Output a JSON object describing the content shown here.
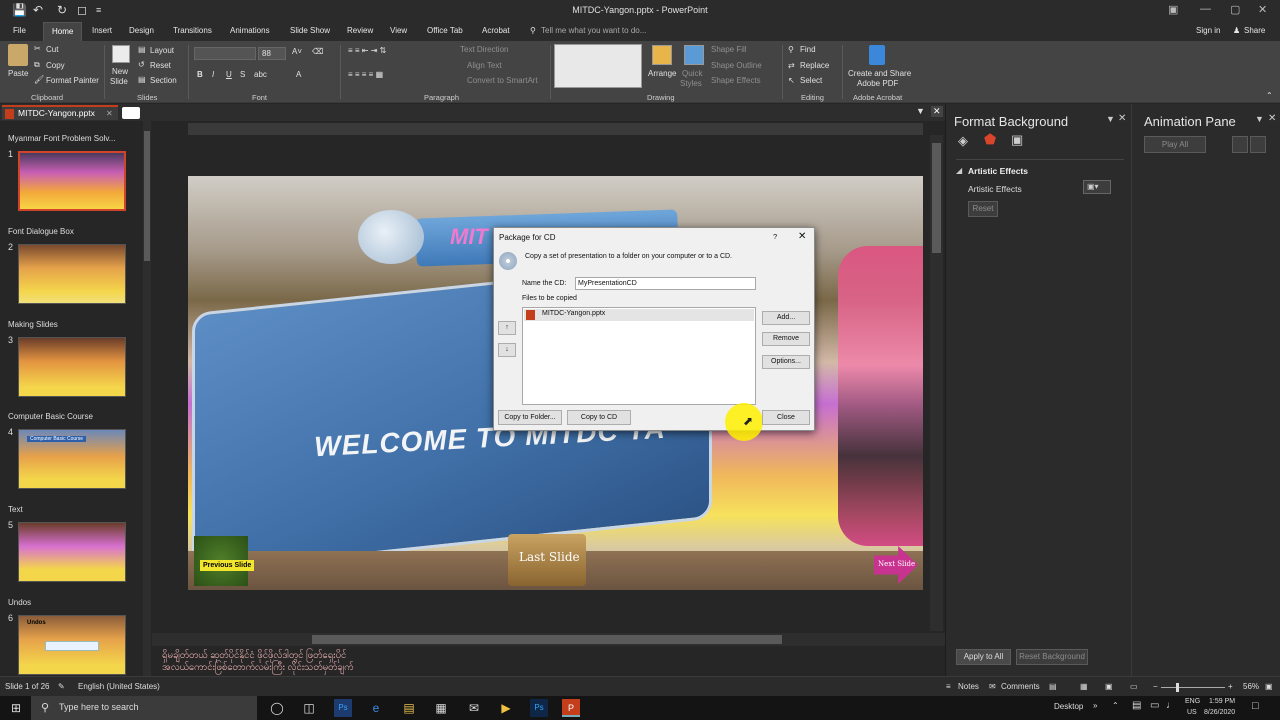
{
  "app": {
    "title": "MITDC-Yangon.pptx - PowerPoint",
    "sign_in": "Sign in",
    "share": "Share"
  },
  "tabs": [
    "File",
    "Home",
    "Insert",
    "Design",
    "Transitions",
    "Animations",
    "Slide Show",
    "Review",
    "View",
    "Office Tab",
    "Acrobat"
  ],
  "tell_me": "Tell me what you want to do...",
  "ribbon": {
    "clipboard": {
      "paste": "Paste",
      "cut": "Cut",
      "copy": "Copy",
      "format_painter": "Format Painter",
      "group": "Clipboard"
    },
    "slides": {
      "new_slide": "New",
      "new_slide2": "Slide",
      "layout": "Layout",
      "reset": "Reset",
      "section": "Section",
      "group": "Slides"
    },
    "font": {
      "size": "88",
      "group": "Font"
    },
    "paragraph": {
      "text_direction": "Text Direction",
      "align_text": "Align Text",
      "convert_smartart": "Convert to SmartArt",
      "group": "Paragraph"
    },
    "drawing": {
      "arrange": "Arrange",
      "quick_styles": "Quick",
      "quick_styles2": "Styles",
      "shape_fill": "Shape Fill",
      "shape_outline": "Shape Outline",
      "shape_effects": "Shape Effects",
      "group": "Drawing"
    },
    "editing": {
      "find": "Find",
      "replace": "Replace",
      "select": "Select",
      "group": "Editing"
    },
    "acrobat": {
      "create": "Create and Share",
      "create2": "Adobe PDF",
      "group": "Adobe Acrobat"
    }
  },
  "document_tab": "MITDC-Yangon.pptx",
  "slides": [
    {
      "num": "1",
      "section": "Myanmar Font Problem Solv...",
      "label": ""
    },
    {
      "num": "2",
      "section": "Font Dialogue Box",
      "label": ""
    },
    {
      "num": "3",
      "section": "Making Slides",
      "label": ""
    },
    {
      "num": "4",
      "section": "Computer Basic Course",
      "label": "Computer Basic Course"
    },
    {
      "num": "5",
      "section": "Text",
      "label": ""
    },
    {
      "num": "6",
      "section": "Undos",
      "label": "Undos"
    }
  ],
  "slide": {
    "welcome": "WELCOME TO MITDC YA",
    "mitdc": "MIT",
    "previous": "Previous Slide",
    "last": "Last Slide",
    "next": "Next Slide"
  },
  "dialog": {
    "title": "Package for CD",
    "help": "?",
    "description": "Copy a set of presentation to a folder on your computer or to a CD.",
    "name_label": "Name the CD:",
    "name_value": "MyPresentationCD",
    "files_label": "Files to be copied",
    "files": [
      "MITDC-Yangon.pptx"
    ],
    "add": "Add...",
    "remove": "Remove",
    "options": "Options...",
    "copy_folder": "Copy to Folder...",
    "copy_cd": "Copy to CD",
    "close": "Close"
  },
  "format_pane": {
    "title": "Format Background",
    "section": "Artistic Effects",
    "row_label": "Artistic Effects",
    "reset": "Reset",
    "apply_all": "Apply to All",
    "reset_background": "Reset Background"
  },
  "animation_pane": {
    "title": "Animation Pane",
    "play_all": "Play All"
  },
  "notes": {
    "line1": "ရှိမချိတ်တယ် ဆုတ်ပိုင်နိုင်ငံ ဖိုင်ဖိုလ်ဒါတွင် ဖြတ်ရှေးပိုင်",
    "line2": "အလယ်ကောင်းဖြစ်တောက်လမ်းကြီး လိုင်းသတ်မှတ်ချက်"
  },
  "status": {
    "slide_of": "Slide 1 of 26",
    "language": "English (United States)",
    "notes": "Notes",
    "comments": "Comments",
    "zoom": "56%"
  },
  "taskbar": {
    "search": "Type here to search",
    "desktop": "Desktop",
    "lang1": "ENG",
    "lang2": "US",
    "time": "1:59 PM",
    "date": "8/26/2020"
  }
}
